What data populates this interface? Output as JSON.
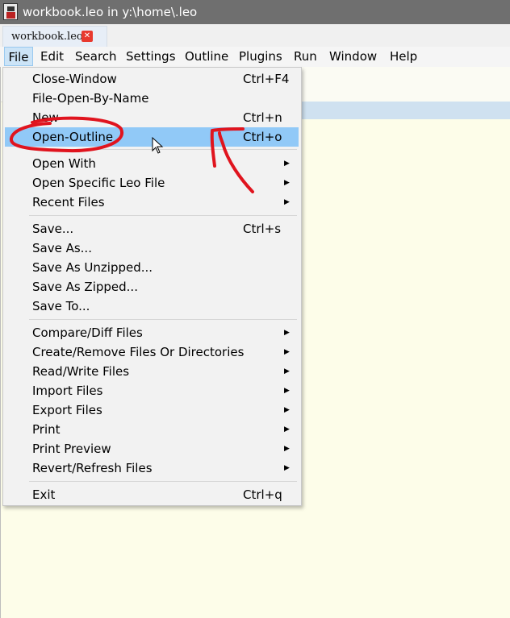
{
  "window": {
    "title": "workbook.leo in y:\\home\\.leo"
  },
  "tabs": [
    {
      "label": "workbook.leo",
      "close_symbol": "✕"
    }
  ],
  "menubar": {
    "items": [
      {
        "label": "File"
      },
      {
        "label": "Edit"
      },
      {
        "label": "Search"
      },
      {
        "label": "Settings"
      },
      {
        "label": "Outline"
      },
      {
        "label": "Plugins"
      },
      {
        "label": "Run"
      },
      {
        "label": "Window"
      },
      {
        "label": "Help"
      }
    ]
  },
  "file_menu": {
    "items": [
      {
        "label": "Close-Window",
        "shortcut": "Ctrl+F4"
      },
      {
        "label": "File-Open-By-Name"
      },
      {
        "label": "New",
        "shortcut": "Ctrl+n"
      },
      {
        "label": "Open-Outline",
        "shortcut": "Ctrl+o"
      },
      {
        "label": "Open With",
        "submenu": "▶"
      },
      {
        "label": "Open Specific Leo File",
        "submenu": "▶"
      },
      {
        "label": "Recent Files",
        "submenu": "▶"
      },
      {
        "label": "Save...",
        "shortcut": "Ctrl+s"
      },
      {
        "label": "Save As..."
      },
      {
        "label": "Save As Unzipped..."
      },
      {
        "label": "Save As Zipped..."
      },
      {
        "label": "Save To..."
      },
      {
        "label": "Compare/Diff Files",
        "submenu": "▶"
      },
      {
        "label": "Create/Remove Files Or Directories",
        "submenu": "▶"
      },
      {
        "label": "Read/Write Files",
        "submenu": "▶"
      },
      {
        "label": "Import Files",
        "submenu": "▶"
      },
      {
        "label": "Export Files",
        "submenu": "▶"
      },
      {
        "label": "Print",
        "submenu": "▶"
      },
      {
        "label": "Print Preview",
        "submenu": "▶"
      },
      {
        "label": "Revert/Refresh Files",
        "submenu": "▶"
      },
      {
        "label": "Exit",
        "shortcut": "Ctrl+q"
      }
    ]
  },
  "colors": {
    "titlebar": "#6f6f6f",
    "menu_highlight": "#91c9f7",
    "body_background": "#fdfde9",
    "annotation_red": "#e0141e"
  },
  "icons": {
    "app": "leo-app-icon",
    "pointer": "mouse-pointer-icon"
  }
}
